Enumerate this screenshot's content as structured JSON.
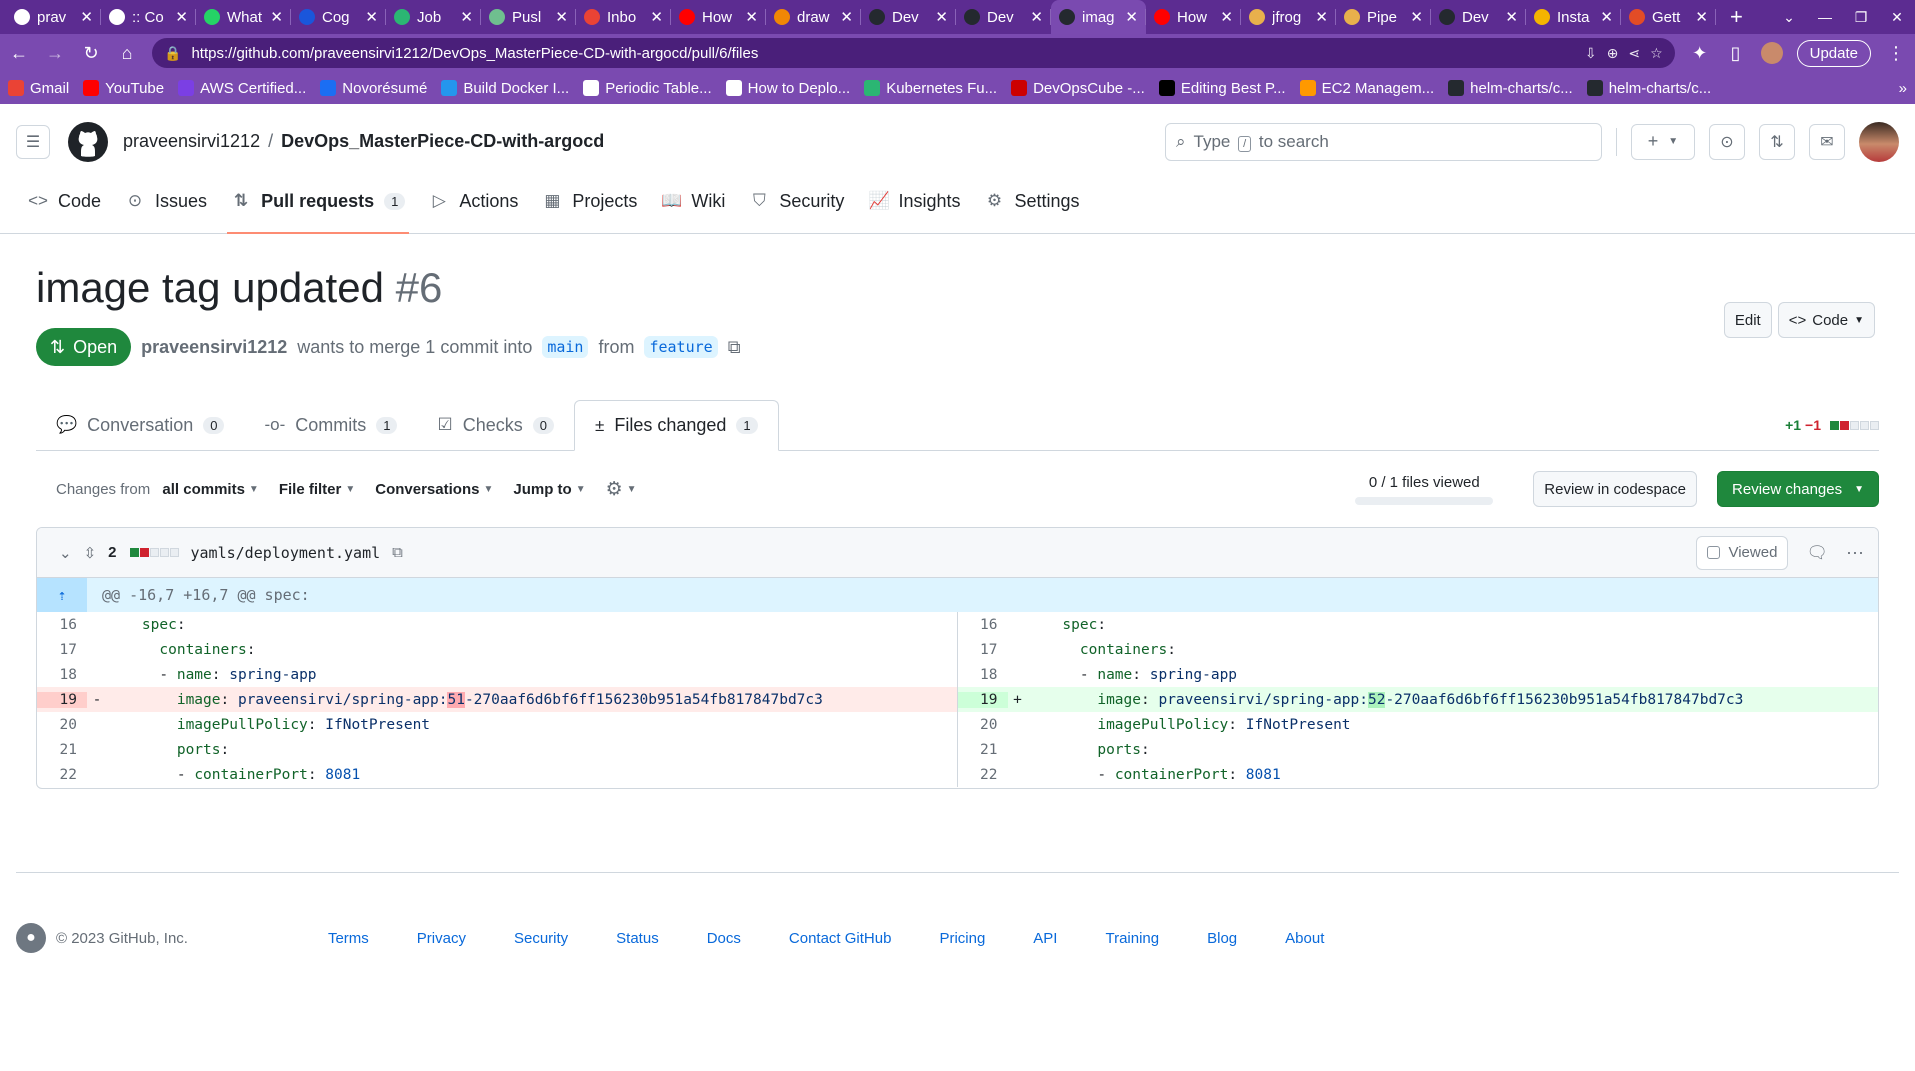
{
  "browser": {
    "tabs": [
      {
        "title": "prav",
        "color": "#ffffff"
      },
      {
        "title": ":: Co",
        "color": "#ffffff"
      },
      {
        "title": "What",
        "color": "#25d366"
      },
      {
        "title": "Cog",
        "color": "#1a56db"
      },
      {
        "title": "Job",
        "color": "#2bb673"
      },
      {
        "title": "Pusl",
        "color": "#6fbf8f"
      },
      {
        "title": "Inbo",
        "color": "#ea4335"
      },
      {
        "title": "How",
        "color": "#ff0000"
      },
      {
        "title": "draw",
        "color": "#f08705"
      },
      {
        "title": "Dev",
        "color": "#24292f"
      },
      {
        "title": "Dev",
        "color": "#24292f"
      },
      {
        "title": "imag",
        "color": "#24292f"
      },
      {
        "title": "How",
        "color": "#ff0000"
      },
      {
        "title": "jfrog",
        "color": "#e8b04c"
      },
      {
        "title": "Pipe",
        "color": "#e8b04c"
      },
      {
        "title": "Dev",
        "color": "#24292f"
      },
      {
        "title": "Insta",
        "color": "#f4b400"
      },
      {
        "title": "Gett",
        "color": "#e34c26"
      }
    ],
    "active_tab_index": 11,
    "new_tab": "+",
    "url": "https://github.com/praveensirvi1212/DevOps_MasterPiece-CD-with-argocd/pull/6/files",
    "update_label": "Update",
    "bookmarks": [
      {
        "label": "Gmail",
        "color": "#ea4335"
      },
      {
        "label": "YouTube",
        "color": "#ff0000"
      },
      {
        "label": "AWS Certified...",
        "color": "#7b3fe4"
      },
      {
        "label": "Novorésumé",
        "color": "#1b6ef3"
      },
      {
        "label": "Build Docker I...",
        "color": "#2496ed"
      },
      {
        "label": "Periodic Table...",
        "color": "#ffffff"
      },
      {
        "label": "How to Deplo...",
        "color": "#ffffff"
      },
      {
        "label": "Kubernetes Fu...",
        "color": "#2bb673"
      },
      {
        "label": "DevOpsCube -...",
        "color": "#cc0000"
      },
      {
        "label": "Editing Best P...",
        "color": "#000000"
      },
      {
        "label": "EC2 Managem...",
        "color": "#ff9900"
      },
      {
        "label": "helm-charts/c...",
        "color": "#24292f"
      },
      {
        "label": "helm-charts/c...",
        "color": "#24292f"
      }
    ],
    "bookmarks_more": "»"
  },
  "header": {
    "owner": "praveensirvi1212",
    "slash": "/",
    "repo": "DevOps_MasterPiece-CD-with-argocd",
    "search_pre": "Type",
    "search_key": "/",
    "search_post": "to search"
  },
  "repo_tabs": [
    {
      "label": "Code",
      "icon": "<>"
    },
    {
      "label": "Issues",
      "icon": "⊙"
    },
    {
      "label": "Pull requests",
      "icon": "⇅",
      "count": "1"
    },
    {
      "label": "Actions",
      "icon": "▷"
    },
    {
      "label": "Projects",
      "icon": "▦"
    },
    {
      "label": "Wiki",
      "icon": "📖"
    },
    {
      "label": "Security",
      "icon": "⛉"
    },
    {
      "label": "Insights",
      "icon": "📈"
    },
    {
      "label": "Settings",
      "icon": "⚙"
    }
  ],
  "pr": {
    "title": "image tag updated",
    "number": "#6",
    "edit_label": "Edit",
    "code_label": "Code",
    "state": "Open",
    "author": "praveensirvi1212",
    "merge_text": "wants to merge 1 commit into",
    "base": "main",
    "from_text": "from",
    "head": "feature"
  },
  "pr_tabs": [
    {
      "label": "Conversation",
      "count": "0",
      "icon": "💬"
    },
    {
      "label": "Commits",
      "count": "1",
      "icon": "-o-"
    },
    {
      "label": "Checks",
      "count": "0",
      "icon": "☑"
    },
    {
      "label": "Files changed",
      "count": "1",
      "icon": "±"
    }
  ],
  "diffstat": {
    "added": "+1",
    "removed": "−1"
  },
  "toolbar": {
    "changes_from": "Changes from",
    "all_commits": "all commits",
    "file_filter": "File filter",
    "conversations": "Conversations",
    "jump_to": "Jump to",
    "files_viewed": "0 / 1 files viewed",
    "files_viewed_fraction": 0,
    "review_codespace": "Review in codespace",
    "review_changes": "Review changes"
  },
  "file": {
    "changes": "2",
    "path": "yamls/deployment.yaml",
    "viewed_label": "Viewed",
    "hunk": "@@ -16,7 +16,7 @@ spec:",
    "left": [
      {
        "n": "16",
        "mk": "",
        "indent": "    ",
        "k": "spec",
        "v": "",
        "type": "ctx"
      },
      {
        "n": "17",
        "mk": "",
        "indent": "      ",
        "k": "containers",
        "v": "",
        "type": "ctx"
      },
      {
        "n": "18",
        "mk": "",
        "indent": "      - ",
        "k": "name",
        "v": "spring-app",
        "type": "ctx"
      },
      {
        "n": "19",
        "mk": "-",
        "indent": "        ",
        "k": "image",
        "v_pre": "praveensirvi/spring-app:",
        "v_hl": "51",
        "v_post": "-270aaf6d6bf6ff156230b951a54fb817847bd7c3",
        "type": "del"
      },
      {
        "n": "20",
        "mk": "",
        "indent": "        ",
        "k": "imagePullPolicy",
        "v": "IfNotPresent",
        "type": "ctx"
      },
      {
        "n": "21",
        "mk": "",
        "indent": "        ",
        "k": "ports",
        "v": "",
        "type": "ctx"
      },
      {
        "n": "22",
        "mk": "",
        "indent": "        - ",
        "k": "containerPort",
        "v": "8081",
        "type": "ctx",
        "num": true
      }
    ],
    "right": [
      {
        "n": "16",
        "mk": "",
        "indent": "    ",
        "k": "spec",
        "v": "",
        "type": "ctx"
      },
      {
        "n": "17",
        "mk": "",
        "indent": "      ",
        "k": "containers",
        "v": "",
        "type": "ctx"
      },
      {
        "n": "18",
        "mk": "",
        "indent": "      - ",
        "k": "name",
        "v": "spring-app",
        "type": "ctx"
      },
      {
        "n": "19",
        "mk": "+",
        "indent": "        ",
        "k": "image",
        "v_pre": "praveensirvi/spring-app:",
        "v_hl": "52",
        "v_post": "-270aaf6d6bf6ff156230b951a54fb817847bd7c3",
        "type": "add"
      },
      {
        "n": "20",
        "mk": "",
        "indent": "        ",
        "k": "imagePullPolicy",
        "v": "IfNotPresent",
        "type": "ctx"
      },
      {
        "n": "21",
        "mk": "",
        "indent": "        ",
        "k": "ports",
        "v": "",
        "type": "ctx"
      },
      {
        "n": "22",
        "mk": "",
        "indent": "        - ",
        "k": "containerPort",
        "v": "8081",
        "type": "ctx",
        "num": true
      }
    ]
  },
  "footer": {
    "copyright": "© 2023 GitHub, Inc.",
    "links": [
      "Terms",
      "Privacy",
      "Security",
      "Status",
      "Docs",
      "Contact GitHub",
      "Pricing",
      "API",
      "Training",
      "Blog",
      "About"
    ]
  }
}
